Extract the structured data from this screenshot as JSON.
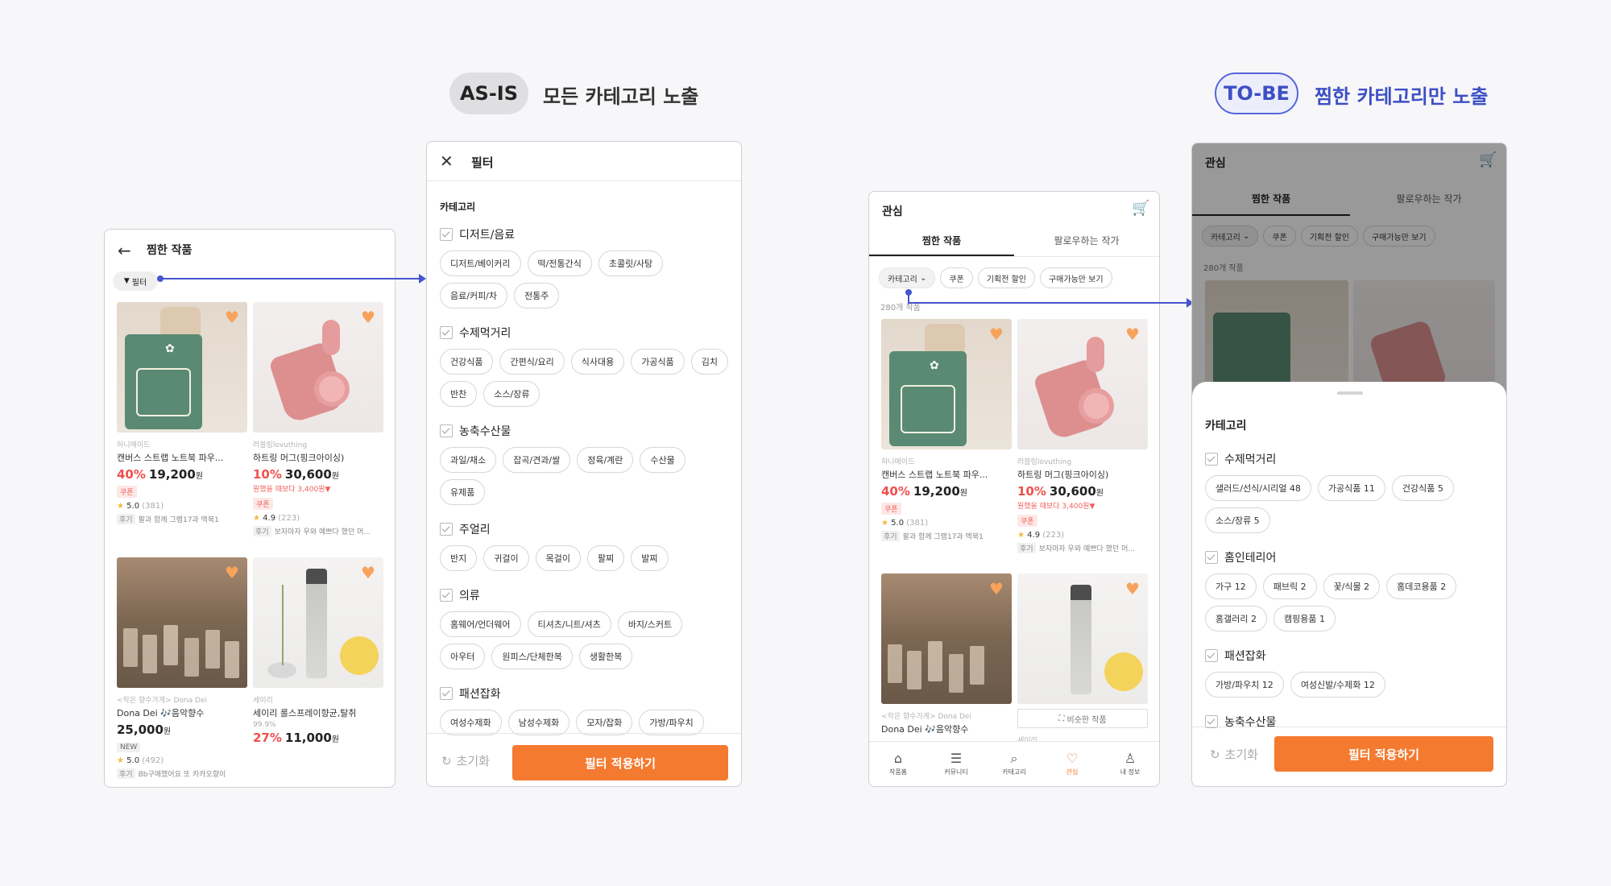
{
  "asis": {
    "pill": "AS-IS",
    "heading": "모든 카테고리 노출"
  },
  "tobe": {
    "pill": "TO-BE",
    "heading": "찜한 카테고리만 노출"
  },
  "wishlist": {
    "title": "찜한 작품",
    "filter_label": "필터"
  },
  "products": [
    {
      "shop": "하니메이드",
      "name": "캔버스 스트랩 노트북 파우...",
      "discount": "40%",
      "price": "19,200",
      "won": "원",
      "badge": "쿠폰",
      "rating": "5.0",
      "count": "(381)",
      "review_tag": "후기",
      "review": "팔과 함께 그램17과 맥북1"
    },
    {
      "shop": "러블링lovuthing",
      "name": "하트링 머그(핑크아이싱)",
      "discount": "10%",
      "price": "30,600",
      "won": "원",
      "nudge": "원했을 때보다 3,400원▼",
      "badge": "쿠폰",
      "rating": "4.9",
      "count": "(223)",
      "review_tag": "후기",
      "review": "보자마자 우와 예쁘다 했던 머..."
    },
    {
      "shop": "<작은 향수가게> Dona Dei",
      "name": "Dona Dei 🎶음악향수",
      "price": "25,000",
      "won": "원",
      "badge": "NEW",
      "rating": "5.0",
      "count": "(492)",
      "review_tag": "후기",
      "review": "Bb구매했어요 또 카카오향이"
    },
    {
      "shop": "세이리",
      "name": "세이리 롤스프레이향균,탈취",
      "orig": "99.9%",
      "discount": "27%",
      "price": "11,000",
      "won": "원"
    }
  ],
  "filter": {
    "title": "필터",
    "section": "카테고리",
    "groups": [
      {
        "label": "디저트/음료",
        "chips": [
          "디저트/베이커리",
          "떡/전통간식",
          "초콜릿/사탕",
          "음료/커피/차",
          "전통주"
        ]
      },
      {
        "label": "수제먹거리",
        "chips": [
          "건강식품",
          "간편식/요리",
          "식사대용",
          "가공식품",
          "김치",
          "반찬",
          "소스/장류"
        ]
      },
      {
        "label": "농축수산물",
        "chips": [
          "과일/채소",
          "잡곡/견과/쌀",
          "정육/계란",
          "수산물",
          "유제품"
        ]
      },
      {
        "label": "주얼리",
        "chips": [
          "반지",
          "귀걸이",
          "목걸이",
          "팔찌",
          "발찌"
        ]
      },
      {
        "label": "의류",
        "chips": [
          "홈웨어/언더웨어",
          "티셔츠/니트/셔츠",
          "바지/스커트",
          "아우터",
          "원피스/단체한복",
          "생활한복"
        ]
      },
      {
        "label": "패션잡화",
        "chips": [
          "여성수제화",
          "남성수제화",
          "모자/잡화",
          "가방/파우치"
        ]
      }
    ],
    "reset": "초기화",
    "apply": "필터 적용하기"
  },
  "interest": {
    "title": "관심",
    "tabs": [
      "찜한 작품",
      "팔로우하는 작가"
    ],
    "chips": [
      "카테고리",
      "쿠폰",
      "기획전 할인",
      "구매가능만 보기"
    ],
    "count": "280개 작품",
    "similar": "비슷한 작품",
    "nav": [
      "작품홈",
      "커뮤니티",
      "카테고리",
      "관심",
      "내 정보"
    ]
  },
  "sheet": {
    "section": "카테고리",
    "groups": [
      {
        "label": "수제먹거리",
        "chips": [
          "샐러드/선식/시리얼 48",
          "가공식품 11",
          "건강식품 5",
          "소스/장류 5"
        ]
      },
      {
        "label": "홈인테리어",
        "chips": [
          "가구 12",
          "패브릭 2",
          "꽃/식물 2",
          "홈데코용품 2",
          "홈갤러리 2",
          "캠핑용품 1"
        ]
      },
      {
        "label": "패션잡화",
        "chips": [
          "가방/파우치 12",
          "여성신발/수제화 12"
        ]
      },
      {
        "label": "농축수산물",
        "chips": []
      }
    ],
    "reset": "초기화",
    "apply": "필터 적용하기"
  },
  "colors": {
    "accent": "#f47a30",
    "connector": "#4655cf",
    "discount": "#f04f4f"
  }
}
